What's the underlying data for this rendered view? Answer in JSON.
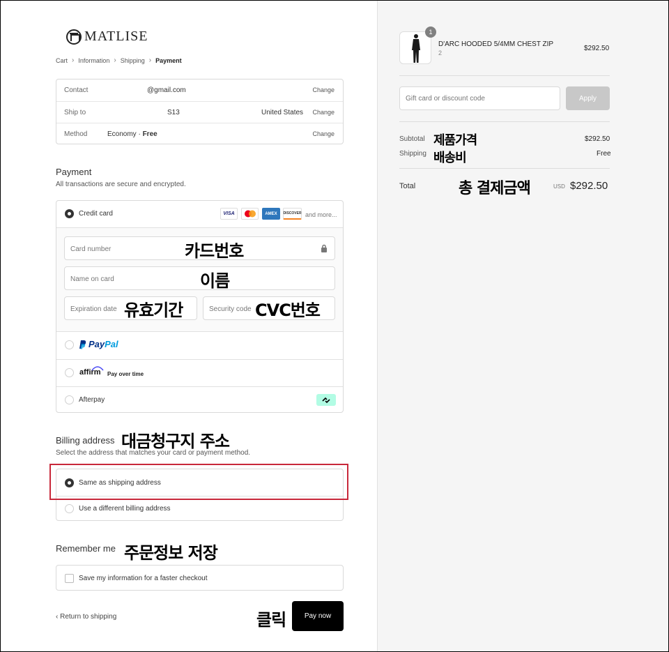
{
  "brand": {
    "name": "MATLISE"
  },
  "breadcrumb": [
    "Cart",
    "Information",
    "Shipping",
    "Payment"
  ],
  "info": {
    "contact_label": "Contact",
    "contact_value": "@gmail.com",
    "ship_label": "Ship to",
    "ship_value": "S13",
    "ship_country": "United States",
    "method_label": "Method",
    "method_value": "Economy · ",
    "method_price": "Free",
    "change": "Change"
  },
  "payment": {
    "title": "Payment",
    "subtitle": "All transactions are secure and encrypted.",
    "credit_card": "Credit card",
    "card_logos": [
      "VISA",
      "AMEX",
      "DISCOVER"
    ],
    "and_more": "and more...",
    "card_number_placeholder": "Card number",
    "name_placeholder": "Name on card",
    "expiry_placeholder": "Expiration date",
    "security_placeholder": "Security code",
    "paypal_a": "Pay",
    "paypal_b": "Pal",
    "affirm": "affirm",
    "affirm_text": "Pay over time",
    "afterpay": "Afterpay"
  },
  "billing": {
    "title": "Billing address",
    "subtitle": "Select the address that matches your card or payment method.",
    "same": "Same as shipping address",
    "different": "Use a different billing address"
  },
  "remember": {
    "title": "Remember me",
    "option": "Save my information for a faster checkout"
  },
  "footer": {
    "return": "Return to shipping",
    "pay_now": "Pay now"
  },
  "annotations": {
    "card_number": "카드번호",
    "name": "이름",
    "expiry": "유효기간",
    "cvc": "CVC번호",
    "billing": "대금청구지 주소",
    "remember": "주문정보 저장",
    "click": "클릭",
    "product_price": "제품가격",
    "shipping_fee": "배송비",
    "total_payment": "총 결제금액"
  },
  "summary": {
    "product_name": "D'ARC HOODED 5/4MM CHEST ZIP",
    "product_variant": "2",
    "product_price": "$292.50",
    "quantity": "1",
    "discount_placeholder": "Gift card or discount code",
    "apply": "Apply",
    "subtotal_label": "Subtotal",
    "subtotal_value": "$292.50",
    "shipping_label": "Shipping",
    "shipping_value": "Free",
    "total_label": "Total",
    "currency": "USD",
    "total_value": "$292.50"
  }
}
